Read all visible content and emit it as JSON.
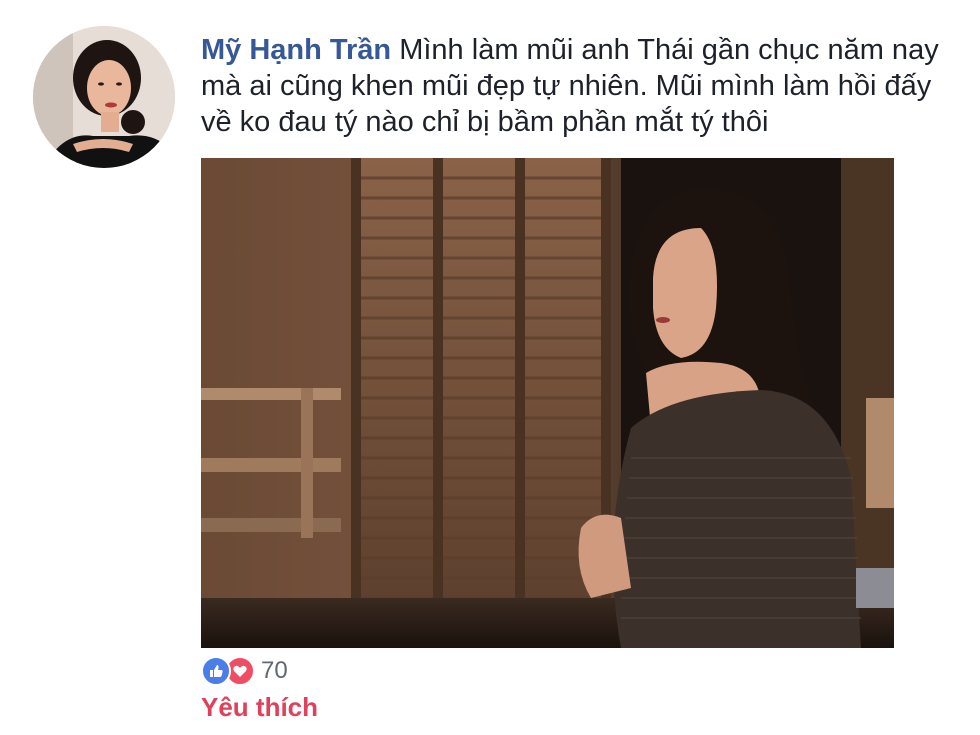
{
  "comment": {
    "author": "Mỹ Hạnh Trần",
    "text": "Mình làm mũi anh Thái gần chục năm nay mà ai cũng khen mũi đẹp tự nhiên. Mũi mình làm hồi đấy về ko đau tý nào chỉ bị bầm phần mắt tý thôi",
    "avatar_icon": "profile-photo",
    "photo_icon": "attached-photo"
  },
  "reactions": {
    "icons": [
      "like-icon",
      "love-icon"
    ],
    "count": "70",
    "like_color": "#4a7ee8",
    "love_color": "#ef4d63"
  },
  "actions": {
    "reaction_label": "Yêu thích",
    "reaction_color": "#e0405a"
  },
  "colors": {
    "author": "#365899",
    "text": "#1d2129"
  }
}
